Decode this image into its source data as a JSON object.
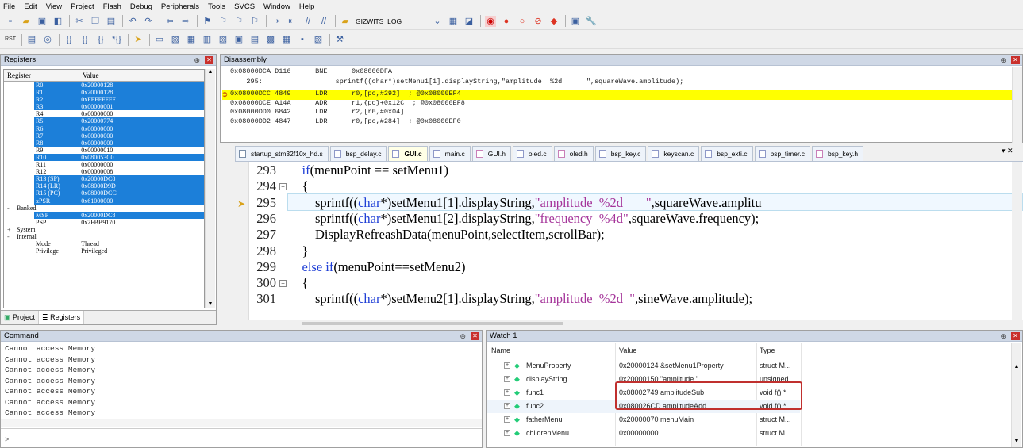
{
  "menubar": [
    "File",
    "Edit",
    "View",
    "Project",
    "Flash",
    "Debug",
    "Peripherals",
    "Tools",
    "SVCS",
    "Window",
    "Help"
  ],
  "toolbar1": {
    "target_name": "GIZWITS_LOG"
  },
  "registers": {
    "title": "Registers",
    "col_register": "Register",
    "col_value": "Value",
    "rows": [
      {
        "name": "R0",
        "value": "0x20000128",
        "sel": true
      },
      {
        "name": "R1",
        "value": "0x20000128",
        "sel": true
      },
      {
        "name": "R2",
        "value": "0xFFFFFFFF",
        "sel": true
      },
      {
        "name": "R3",
        "value": "0x00000001",
        "sel": true
      },
      {
        "name": "R4",
        "value": "0x00000000",
        "sel": false
      },
      {
        "name": "R5",
        "value": "0x20000774",
        "sel": true
      },
      {
        "name": "R6",
        "value": "0x00000000",
        "sel": true
      },
      {
        "name": "R7",
        "value": "0x00000000",
        "sel": true
      },
      {
        "name": "R8",
        "value": "0x00000000",
        "sel": true
      },
      {
        "name": "R9",
        "value": "0x00000010",
        "sel": false
      },
      {
        "name": "R10",
        "value": "0x080053C0",
        "sel": true
      },
      {
        "name": "R11",
        "value": "0x00000000",
        "sel": false
      },
      {
        "name": "R12",
        "value": "0x00000008",
        "sel": false
      },
      {
        "name": "R13 (SP)",
        "value": "0x20000DC8",
        "sel": true
      },
      {
        "name": "R14 (LR)",
        "value": "0x08000D9D",
        "sel": true
      },
      {
        "name": "R15 (PC)",
        "value": "0x08000DCC",
        "sel": true
      },
      {
        "name": "xPSR",
        "value": "0x61000000",
        "sel": true,
        "indent": "+"
      },
      {
        "name": "Banked",
        "value": "",
        "sel": false,
        "indent": "-",
        "group": true
      },
      {
        "name": "MSP",
        "value": "0x20000DC8",
        "sel": true
      },
      {
        "name": "PSP",
        "value": "0x2FBB9170",
        "sel": false
      },
      {
        "name": "System",
        "value": "",
        "sel": false,
        "indent": "+",
        "group": true
      },
      {
        "name": "Internal",
        "value": "",
        "sel": false,
        "indent": "-",
        "group": true
      },
      {
        "name": "Mode",
        "value": "Thread",
        "sel": false
      },
      {
        "name": "Privilege",
        "value": "Privileged",
        "sel": false
      }
    ],
    "tab_project": "Project",
    "tab_registers": "Registers"
  },
  "disassembly": {
    "title": "Disassembly",
    "lines": [
      "0x08000DCA D116      BNE      0x08000DFA",
      "    295:                  sprintf((char*)setMenu1[1].displayString,\"amplitude  %2d      \",squareWave.amplitude);",
      "0x08000DCC 4849      LDR      r0,[pc,#292]  ; @0x08000EF4",
      "0x08000DCE A14A      ADR      r1,{pc}+0x12C  ; @0x08000EF8",
      "0x08000DD0 6842      LDR      r2,[r0,#0x04]",
      "0x08000DD2 4847      LDR      r0,[pc,#284]  ; @0x08000EF0"
    ]
  },
  "tabs": [
    "startup_stm32f10x_hd.s",
    "bsp_delay.c",
    "GUI.c",
    "main.c",
    "GUI.h",
    "oled.c",
    "oled.h",
    "bsp_key.c",
    "keyscan.c",
    "bsp_exti.c",
    "bsp_timer.c",
    "bsp_key.h"
  ],
  "active_tab": "GUI.c",
  "editor": {
    "lines": [
      {
        "num": "293",
        "parts": [
          [
            "    ",
            ""
          ],
          [
            "if",
            "kw"
          ],
          [
            "(menuPoint == setMenu1)",
            ""
          ]
        ]
      },
      {
        "num": "294",
        "parts": [
          [
            "    {",
            ""
          ]
        ]
      },
      {
        "num": "295",
        "parts": [
          [
            "        sprintf((",
            ""
          ],
          [
            "char",
            "kw"
          ],
          [
            "*)setMenu1[1].displayString,",
            ""
          ],
          [
            "\"amplitude  %2d       \"",
            "str"
          ],
          [
            ",squareWave.amplitu",
            ""
          ]
        ]
      },
      {
        "num": "296",
        "parts": [
          [
            "        sprintf((",
            ""
          ],
          [
            "char",
            "kw"
          ],
          [
            "*)setMenu1[2].displayString,",
            ""
          ],
          [
            "\"frequency  %4d\"",
            "str"
          ],
          [
            ",squareWave.frequency);",
            ""
          ]
        ]
      },
      {
        "num": "297",
        "parts": [
          [
            "        DisplayRefreashData(menuPoint,selectItem,scrollBar);",
            ""
          ]
        ]
      },
      {
        "num": "298",
        "parts": [
          [
            "    }",
            ""
          ]
        ]
      },
      {
        "num": "299",
        "parts": [
          [
            "    ",
            ""
          ],
          [
            "else if",
            "kw"
          ],
          [
            "(menuPoint==setMenu2)",
            ""
          ]
        ]
      },
      {
        "num": "300",
        "parts": [
          [
            "    {",
            ""
          ]
        ]
      },
      {
        "num": "301",
        "parts": [
          [
            "        sprintf((",
            ""
          ],
          [
            "char",
            "kw"
          ],
          [
            "*)setMenu2[1].displayString,",
            ""
          ],
          [
            "\"amplitude  %2d  \"",
            "str"
          ],
          [
            ",sineWave.amplitude);",
            ""
          ]
        ]
      }
    ]
  },
  "command": {
    "title": "Command",
    "lines": [
      "Cannot access Memory",
      "Cannot access Memory",
      "Cannot access Memory",
      "Cannot access Memory",
      "Cannot access Memory",
      "Cannot access Memory",
      "Cannot access Memory"
    ],
    "prompt": ">"
  },
  "watch": {
    "title": "Watch 1",
    "col_name": "Name",
    "col_value": "Value",
    "col_type": "Type",
    "rows": [
      {
        "name": "MenuProperty",
        "value": "0x20000124 &setMenu1Property",
        "type": "struct M..."
      },
      {
        "name": "displayString",
        "value": "0x20000150 \"amplitude   \"",
        "type": "unsigned..."
      },
      {
        "name": "func1",
        "value": "0x08002749 amplitudeSub",
        "type": "void f()  *"
      },
      {
        "name": "func2",
        "value": "0x080026CD amplitudeAdd",
        "type": "void f()  *"
      },
      {
        "name": "fatherMenu",
        "value": "0x20000070 menuMain",
        "type": "struct M..."
      },
      {
        "name": "childrenMenu",
        "value": "0x00000000",
        "type": "struct M..."
      }
    ]
  }
}
